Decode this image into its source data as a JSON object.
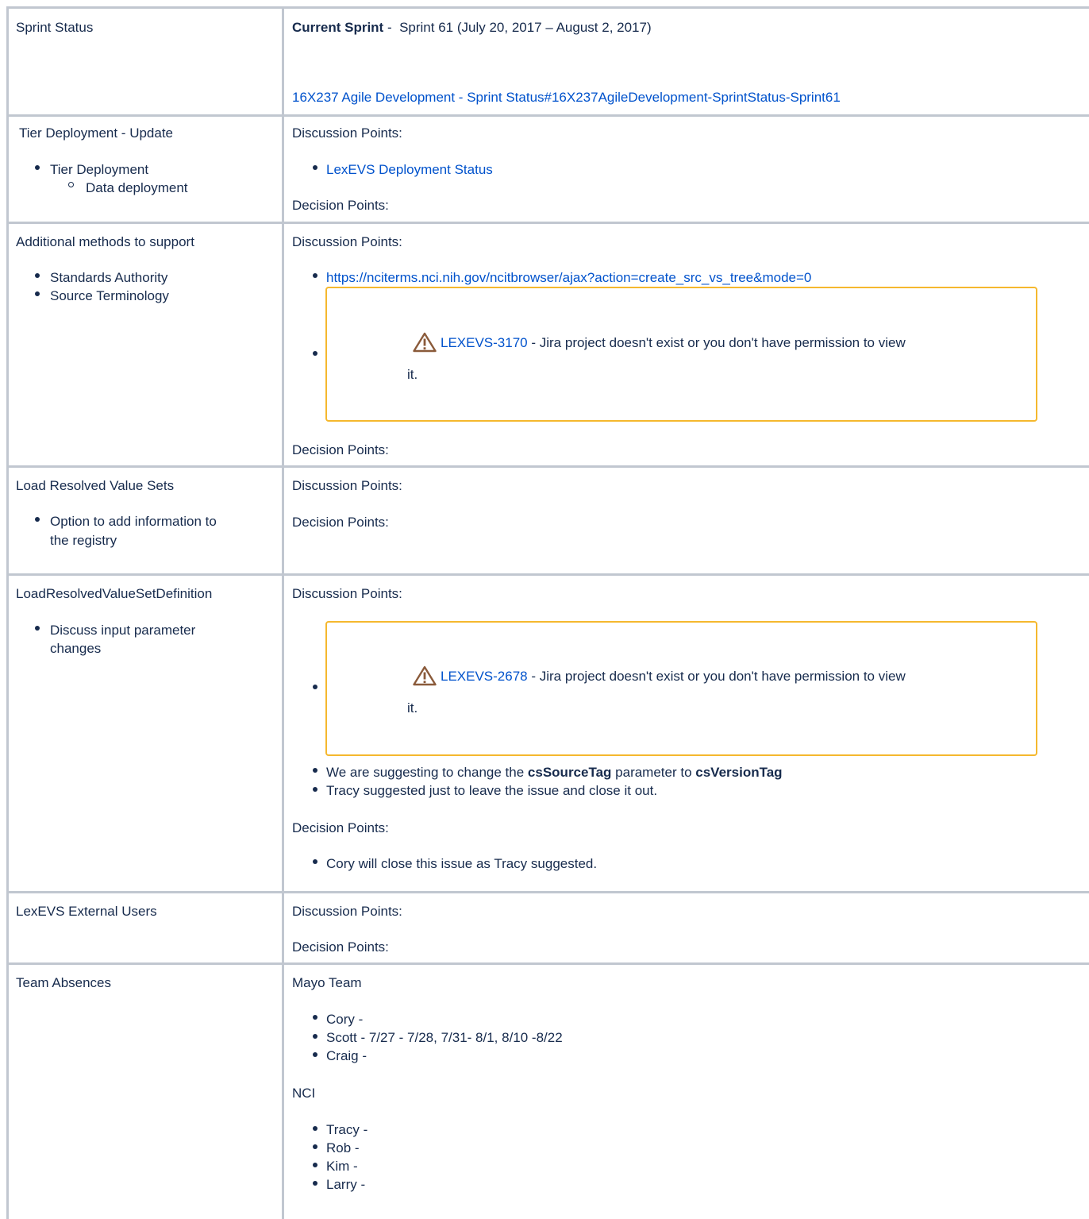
{
  "rows": {
    "sprint": {
      "label": "Sprint Status",
      "current_sprint_label": "Current Sprint",
      "current_sprint_sep": " - ",
      "current_sprint_value": "Sprint 61 (July 20, 2017 – August 2, 2017)",
      "link": "16X237 Agile Development - Sprint Status#16X237AgileDevelopment-SprintStatus-Sprint61"
    },
    "tier": {
      "label": "Tier Deployment - Update",
      "items": [
        "Tier Deployment"
      ],
      "subitems": [
        "Data deployment"
      ],
      "discussion_label": "Discussion Points:",
      "discussion_links": [
        "LexEVS Deployment Status"
      ],
      "decision_label": "Decision Points:"
    },
    "additional": {
      "label": "Additional methods to support",
      "items": [
        "Standards Authority",
        "Source Terminology"
      ],
      "discussion_label": "Discussion Points:",
      "url": "https://nciterms.nci.nih.gov/ncitbrowser/ajax?action=create_src_vs_tree&mode=0",
      "jira_key": "LEXEVS-3170",
      "jira_msg_line1": " - Jira project doesn't exist or you don't have permission to view",
      "jira_msg_line2": "it.",
      "decision_label": "Decision Points:"
    },
    "load_sets": {
      "label": "Load Resolved Value Sets",
      "items_line1": "Option to add information to",
      "items_line2": "the registry",
      "discussion_label": "Discussion Points:",
      "decision_label": "Decision Points:"
    },
    "load_def": {
      "label": "LoadResolvedValueSetDefinition",
      "items_line1": "Discuss input parameter",
      "items_line2": "changes",
      "discussion_label": "Discussion Points:",
      "jira_key": "LEXEVS-2678",
      "jira_msg_line1": " - Jira project doesn't exist or you don't have permission to view",
      "jira_msg_line2": "it.",
      "suggest_prefix": "We are suggesting to change the ",
      "suggest_bold1": "csSourceTag",
      "suggest_mid": " parameter to ",
      "suggest_bold2": "csVersionTag",
      "suggest_2": "Tracy suggested just to leave the issue and close it out.",
      "decision_label": "Decision Points:",
      "decision_1": "Cory will close this issue as Tracy suggested."
    },
    "external": {
      "label": "LexEVS External Users",
      "discussion_label": "Discussion Points:",
      "decision_label": "Decision Points:"
    },
    "absences": {
      "label": "Team Absences",
      "mayo_label": "Mayo Team",
      "mayo": [
        "Cory -",
        "Scott - 7/27 - 7/28, 7/31- 8/1, 8/10 -8/22",
        "Craig -"
      ],
      "nci_label": "NCI",
      "nci": [
        "Tracy -",
        "Rob -",
        "Kim -",
        "Larry -"
      ]
    }
  },
  "colors": {
    "link": "#0052cc",
    "text": "#172b4d",
    "grid": "#c1c7d0",
    "jira_border": "#f5b82e"
  }
}
